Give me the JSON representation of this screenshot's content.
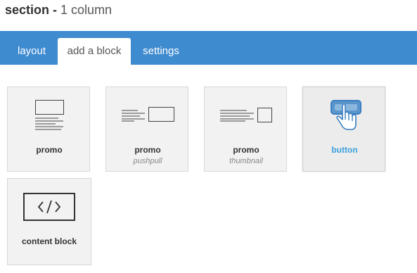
{
  "header": {
    "title_bold": "section -",
    "title_rest": "1 column"
  },
  "tabs": [
    {
      "label": "layout",
      "active": false
    },
    {
      "label": "add a block",
      "active": true
    },
    {
      "label": "settings",
      "active": false
    }
  ],
  "blocks": [
    {
      "title": "promo",
      "subtitle": "",
      "icon": "promo-icon"
    },
    {
      "title": "promo",
      "subtitle": "pushpull",
      "icon": "promo-pushpull-icon"
    },
    {
      "title": "promo",
      "subtitle": "thumbnail",
      "icon": "promo-thumbnail-icon"
    },
    {
      "title": "button",
      "subtitle": "",
      "icon": "button-click-icon",
      "hover_color": "#3aa0dc"
    },
    {
      "title": "content block",
      "subtitle": "",
      "icon": "code-icon"
    }
  ],
  "colors": {
    "tabbar": "#3f8bd0",
    "icon_accent": "#3a7fc1",
    "hover_text": "#3aa0dc"
  }
}
